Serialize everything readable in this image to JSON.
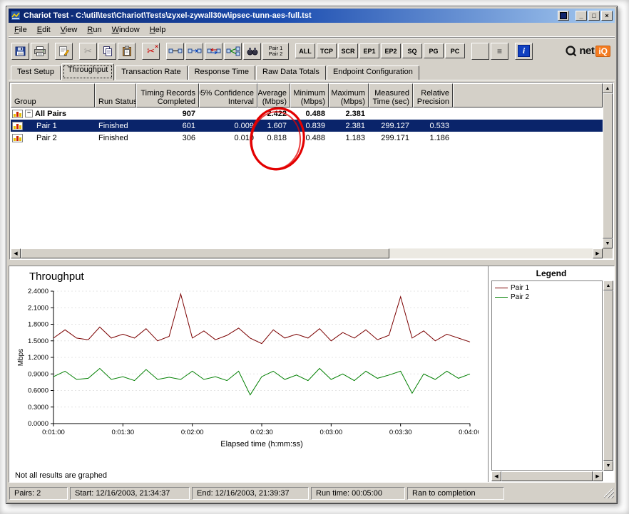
{
  "window": {
    "title": "Chariot Test - C:\\util\\test\\Chariot\\Tests\\zyxel-zywall30w\\ipsec-tunn-aes-full.tst"
  },
  "icons": {
    "minimize": "_",
    "maximize": "□",
    "close": "×",
    "scroll_up": "▲",
    "scroll_down": "▼",
    "scroll_left": "◀",
    "scroll_right": "▶",
    "cut": "✂",
    "delete_pair": "✂",
    "delete_x": "×",
    "notes": "≡",
    "help": "i",
    "expand_minus": "−"
  },
  "menu": {
    "items": [
      "File",
      "Edit",
      "View",
      "Run",
      "Window",
      "Help"
    ]
  },
  "toolbar": {
    "pair_button": {
      "line1": "Pair 1",
      "line2": "Pair 2"
    },
    "filter_buttons": [
      "ALL",
      "TCP",
      "SCR",
      "EP1",
      "EP2",
      "SQ",
      "PG",
      "PC"
    ],
    "brand": {
      "net": "net",
      "iq": "iQ"
    }
  },
  "tabs": {
    "items": [
      "Test Setup",
      "Throughput",
      "Transaction Rate",
      "Response Time",
      "Raw Data Totals",
      "Endpoint Configuration"
    ],
    "active": 1
  },
  "table": {
    "columns": [
      {
        "label": [
          "Group"
        ],
        "align": "left"
      },
      {
        "label": [
          "Run Status"
        ],
        "align": "left"
      },
      {
        "label": [
          "Timing Records",
          "Completed"
        ],
        "align": "right"
      },
      {
        "label": [
          "95% Confidence",
          "Interval"
        ],
        "align": "right"
      },
      {
        "label": [
          "Average",
          "(Mbps)"
        ],
        "align": "right"
      },
      {
        "label": [
          "Minimum",
          "(Mbps)"
        ],
        "align": "right"
      },
      {
        "label": [
          "Maximum",
          "(Mbps)"
        ],
        "align": "right"
      },
      {
        "label": [
          "Measured",
          "Time (sec)"
        ],
        "align": "right"
      },
      {
        "label": [
          "Relative",
          "Precision"
        ],
        "align": "right"
      }
    ],
    "rows": [
      {
        "cells": [
          "All Pairs",
          "",
          "907",
          "",
          "2.422",
          "0.488",
          "2.381",
          "",
          ""
        ],
        "bold": true,
        "selected": false,
        "expand": true,
        "indent": false
      },
      {
        "cells": [
          "Pair 1",
          "Finished",
          "601",
          "0.009",
          "1.607",
          "0.839",
          "2.381",
          "299.127",
          "0.533"
        ],
        "bold": false,
        "selected": true,
        "expand": false,
        "indent": true
      },
      {
        "cells": [
          "Pair 2",
          "Finished",
          "306",
          "0.010",
          "0.818",
          "0.488",
          "1.183",
          "299.171",
          "1.186"
        ],
        "bold": false,
        "selected": false,
        "expand": false,
        "indent": true
      }
    ]
  },
  "annotation": {
    "color": "#e30000"
  },
  "chart_data": {
    "type": "line",
    "title": "Throughput",
    "xlabel": "Elapsed time (h:mm:ss)",
    "ylabel": "Mbps",
    "ylim": [
      0,
      2.4
    ],
    "yticks": [
      "0.0000",
      "0.3000",
      "0.6000",
      "0.9000",
      "1.2000",
      "1.5000",
      "1.8000",
      "2.1000",
      "2.4000"
    ],
    "xticks": [
      "0:01:00",
      "0:01:30",
      "0:02:00",
      "0:02:30",
      "0:03:00",
      "0:03:30",
      "0:04:00"
    ],
    "note": "Not all results are graphed",
    "x_seconds": [
      60,
      65,
      70,
      75,
      80,
      85,
      90,
      95,
      100,
      105,
      110,
      115,
      120,
      125,
      130,
      135,
      140,
      145,
      150,
      155,
      160,
      165,
      170,
      175,
      180,
      185,
      190,
      195,
      200,
      205,
      210,
      215,
      220,
      225,
      230,
      235,
      240
    ],
    "series": [
      {
        "name": "Pair 1",
        "color": "#7b0000",
        "values": [
          1.55,
          1.7,
          1.55,
          1.52,
          1.75,
          1.55,
          1.62,
          1.55,
          1.72,
          1.5,
          1.58,
          2.35,
          1.55,
          1.68,
          1.52,
          1.6,
          1.73,
          1.55,
          1.45,
          1.7,
          1.55,
          1.62,
          1.55,
          1.72,
          1.5,
          1.65,
          1.55,
          1.7,
          1.52,
          1.6,
          2.3,
          1.55,
          1.68,
          1.5,
          1.62,
          1.55,
          1.48
        ]
      },
      {
        "name": "Pair 2",
        "color": "#007f00",
        "values": [
          0.85,
          0.95,
          0.8,
          0.82,
          1.0,
          0.8,
          0.85,
          0.78,
          0.98,
          0.8,
          0.84,
          0.8,
          0.95,
          0.8,
          0.85,
          0.78,
          0.95,
          0.52,
          0.85,
          0.95,
          0.8,
          0.88,
          0.78,
          1.0,
          0.8,
          0.9,
          0.78,
          0.95,
          0.82,
          0.88,
          0.95,
          0.55,
          0.9,
          0.8,
          0.95,
          0.82,
          0.9
        ]
      }
    ],
    "legend_position": "right"
  },
  "legend": {
    "title": "Legend",
    "entries": [
      {
        "label": "Pair 1",
        "color": "#7b0000"
      },
      {
        "label": "Pair 2",
        "color": "#007f00"
      }
    ]
  },
  "status_bar": {
    "panels": [
      "Pairs: 2",
      "Start: 12/16/2003, 21:34:37",
      "End: 12/16/2003, 21:39:37",
      "Run time: 00:05:00",
      "Ran to completion"
    ]
  }
}
